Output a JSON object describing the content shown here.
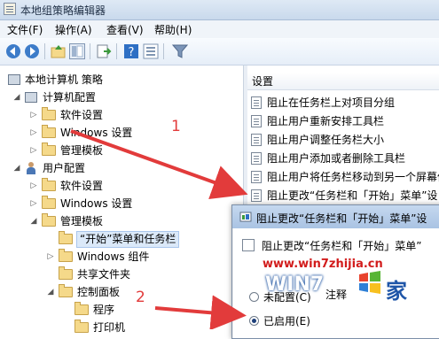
{
  "window": {
    "title": "本地组策略编辑器"
  },
  "menu": [
    "文件(F)",
    "操作(A)",
    "查看(V)",
    "帮助(H)"
  ],
  "toolbar": [
    "back-icon",
    "forward-icon",
    "up-folder-icon",
    "show-hide-tree-icon",
    "export-icon",
    "help-icon",
    "properties-icon",
    "filter-icon"
  ],
  "tree": {
    "root": "本地计算机 策略",
    "computer_config": "计算机配置",
    "cc_software": "软件设置",
    "cc_windows": "Windows 设置",
    "cc_admin": "管理模板",
    "user_config": "用户配置",
    "uc_software": "软件设置",
    "uc_windows": "Windows 设置",
    "uc_admin": "管理模板",
    "start_taskbar": "“开始”菜单和任务栏",
    "win_components": "Windows 组件",
    "shared_folders": "共享文件夹",
    "control_panel": "控制面板",
    "programs": "程序",
    "printers": "打印机"
  },
  "list": {
    "header": "设置",
    "items": [
      "阻止在任务栏上对项目分组",
      "阻止用户重新安排工具栏",
      "阻止用户调整任务栏大小",
      "阻止用户添加或者删除工具栏",
      "阻止用户将任务栏移动到另一个屏幕停",
      "阻止更改“任务栏和「开始」菜单”设"
    ]
  },
  "dialog": {
    "title": "阻止更改“任务栏和「开始」菜单”设",
    "subtitle": "阻止更改“任务栏和「开始」菜单”",
    "option_not_configured": "未配置(C)",
    "option_comment_label": "注释",
    "option_enabled": "已启用(E)"
  },
  "annotations": {
    "step1": "1",
    "step2": "2",
    "arrow_color": "#e23b3b"
  },
  "watermark": {
    "url": "www.win7zhijia.cn",
    "brand": "WIN7",
    "char": "家"
  }
}
